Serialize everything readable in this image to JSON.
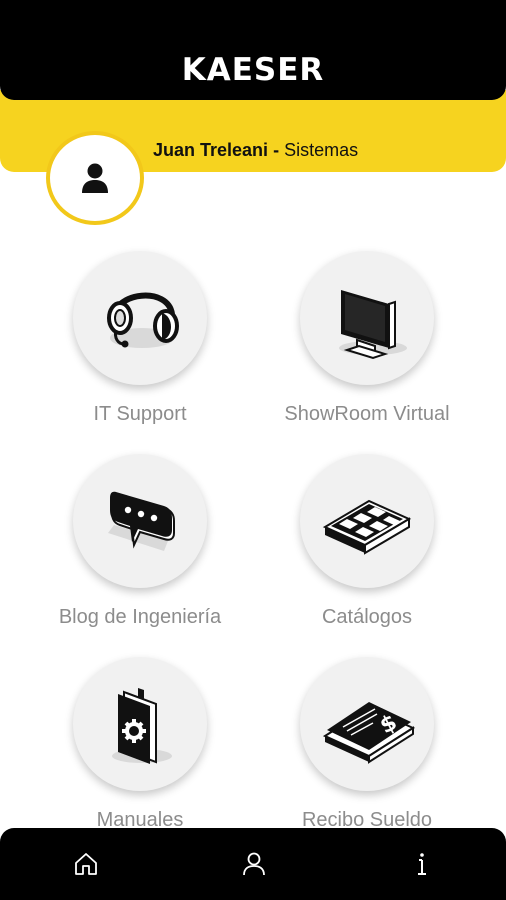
{
  "header": {
    "logo_text": "KAESER"
  },
  "user": {
    "name": "Juan Treleani",
    "separator": " - ",
    "department": "Sistemas",
    "avatar_icon": "user-avatar-icon"
  },
  "menu": [
    {
      "label": "IT Support",
      "icon": "headset-icon"
    },
    {
      "label": "ShowRoom Virtual",
      "icon": "monitor-icon"
    },
    {
      "label": "Blog de Ingeniería",
      "icon": "chat-bubble-icon"
    },
    {
      "label": "Catálogos",
      "icon": "catalog-tray-icon"
    },
    {
      "label": "Manuales",
      "icon": "manual-book-icon"
    },
    {
      "label": "Recibo Sueldo",
      "icon": "salary-receipt-icon"
    }
  ],
  "bottom_nav": [
    {
      "icon": "home-icon"
    },
    {
      "icon": "profile-icon"
    },
    {
      "icon": "info-icon"
    }
  ],
  "colors": {
    "accent": "#f6d31f",
    "dark": "#000000",
    "label": "#8c8c8c"
  }
}
